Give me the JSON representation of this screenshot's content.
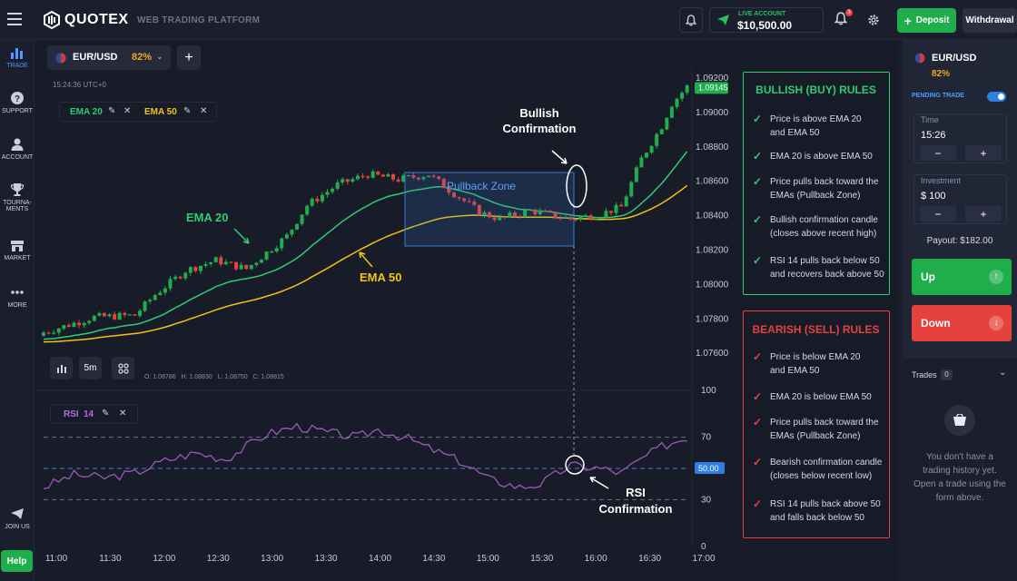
{
  "app": {
    "logo": "QUOTEX",
    "subtitle": "WEB TRADING PLATFORM"
  },
  "header": {
    "account_type": "LIVE ACCOUNT",
    "balance": "$10,500.00",
    "notification_count": "3",
    "deposit_label": "Deposit",
    "withdrawal_label": "Withdrawal"
  },
  "sidebar": {
    "items": [
      {
        "label": "TRADE",
        "icon": "bar-chart-icon"
      },
      {
        "label": "SUPPORT",
        "icon": "question-icon"
      },
      {
        "label": "ACCOUNT",
        "icon": "user-icon"
      },
      {
        "label": "TOURNA-",
        "label2": "MENTS",
        "icon": "trophy-icon"
      },
      {
        "label": "MARKET",
        "icon": "shop-icon"
      },
      {
        "label": "MORE",
        "icon": "more-icon"
      }
    ],
    "join_label": "JOIN US",
    "help_label": "Help"
  },
  "asset": {
    "name": "EUR/USD",
    "payout_pct": "82%",
    "time": "15:24:36",
    "tz": "UTC+0"
  },
  "indicators": {
    "ema20": "EMA 20",
    "ema50": "EMA 50",
    "rsi": "RSI",
    "rsi_period": "14"
  },
  "chart_toolbar": {
    "timeframe": "5m",
    "ohlc": {
      "o": "O: 1.08786",
      "h": "H: 1.08830",
      "l": "L: 1.08750",
      "c": "C: 1.08815"
    }
  },
  "annotations": {
    "bullish": [
      "Bullish",
      "Confirmation"
    ],
    "pullback": "Pullback Zone",
    "ema20": "EMA 20",
    "ema50": "EMA 50",
    "rsi": [
      "RSI",
      "Confirmation"
    ]
  },
  "price_axis": {
    "ticks": [
      "1.09200",
      "1.09000",
      "1.08800",
      "1.08600",
      "1.08400",
      "1.08200",
      "1.08000",
      "1.07800",
      "1.07600"
    ],
    "current": "1.09145"
  },
  "rsi_axis": {
    "ticks": [
      "100",
      "70",
      "30",
      "0"
    ],
    "current": "50.00"
  },
  "time_axis": [
    "11:00",
    "11:30",
    "12:00",
    "12:30",
    "13:00",
    "13:30",
    "14:00",
    "14:30",
    "15:00",
    "15:30",
    "16:00",
    "16:30",
    "17:00"
  ],
  "bullish_rules": {
    "title": "BULLISH (BUY) RULES",
    "items": [
      [
        "Price is above EMA 20",
        "and EMA 50"
      ],
      [
        "EMA 20 is above EMA 50"
      ],
      [
        "Price pulls back toward the",
        "EMAs (Pullback Zone)"
      ],
      [
        "Bullish confirmation candle",
        "(closes above recent high)"
      ],
      [
        "RSI 14 pulls back below 50",
        "and recovers back above 50"
      ]
    ]
  },
  "bearish_rules": {
    "title": "BEARISH (SELL) RULES",
    "items": [
      [
        "Price is below EMA 20",
        "and EMA 50"
      ],
      [
        "EMA 20 is below EMA 50"
      ],
      [
        "Price pulls back toward the",
        "EMAs (Pullback Zone)"
      ],
      [
        "Bearish confirmation candle",
        "(closes below recent low)"
      ],
      [
        "RSI 14 pulls back above 50",
        "and falls back below 50"
      ]
    ]
  },
  "trade_panel": {
    "asset": "EUR/USD",
    "payout_pct": "82%",
    "pending_label": "PENDING TRADE",
    "time_label": "Time",
    "time_value": "15:26",
    "investment_label": "Investment",
    "investment_value": "$ 100",
    "minus": "−",
    "plus": "+",
    "payout_text": "Payout: $182.00",
    "up_label": "Up",
    "down_label": "Down",
    "trades_label": "Trades",
    "trades_count": "0",
    "empty_text": [
      "You don't have a",
      "trading history yet.",
      "Open a trade using the",
      "form above."
    ]
  },
  "colors": {
    "ema20": "#2ecc71",
    "ema50": "#f1c40f",
    "rsi": "#9b59b6",
    "up": "#1fae4b",
    "down": "#e5423d",
    "pullback": "#3a7bd5"
  }
}
